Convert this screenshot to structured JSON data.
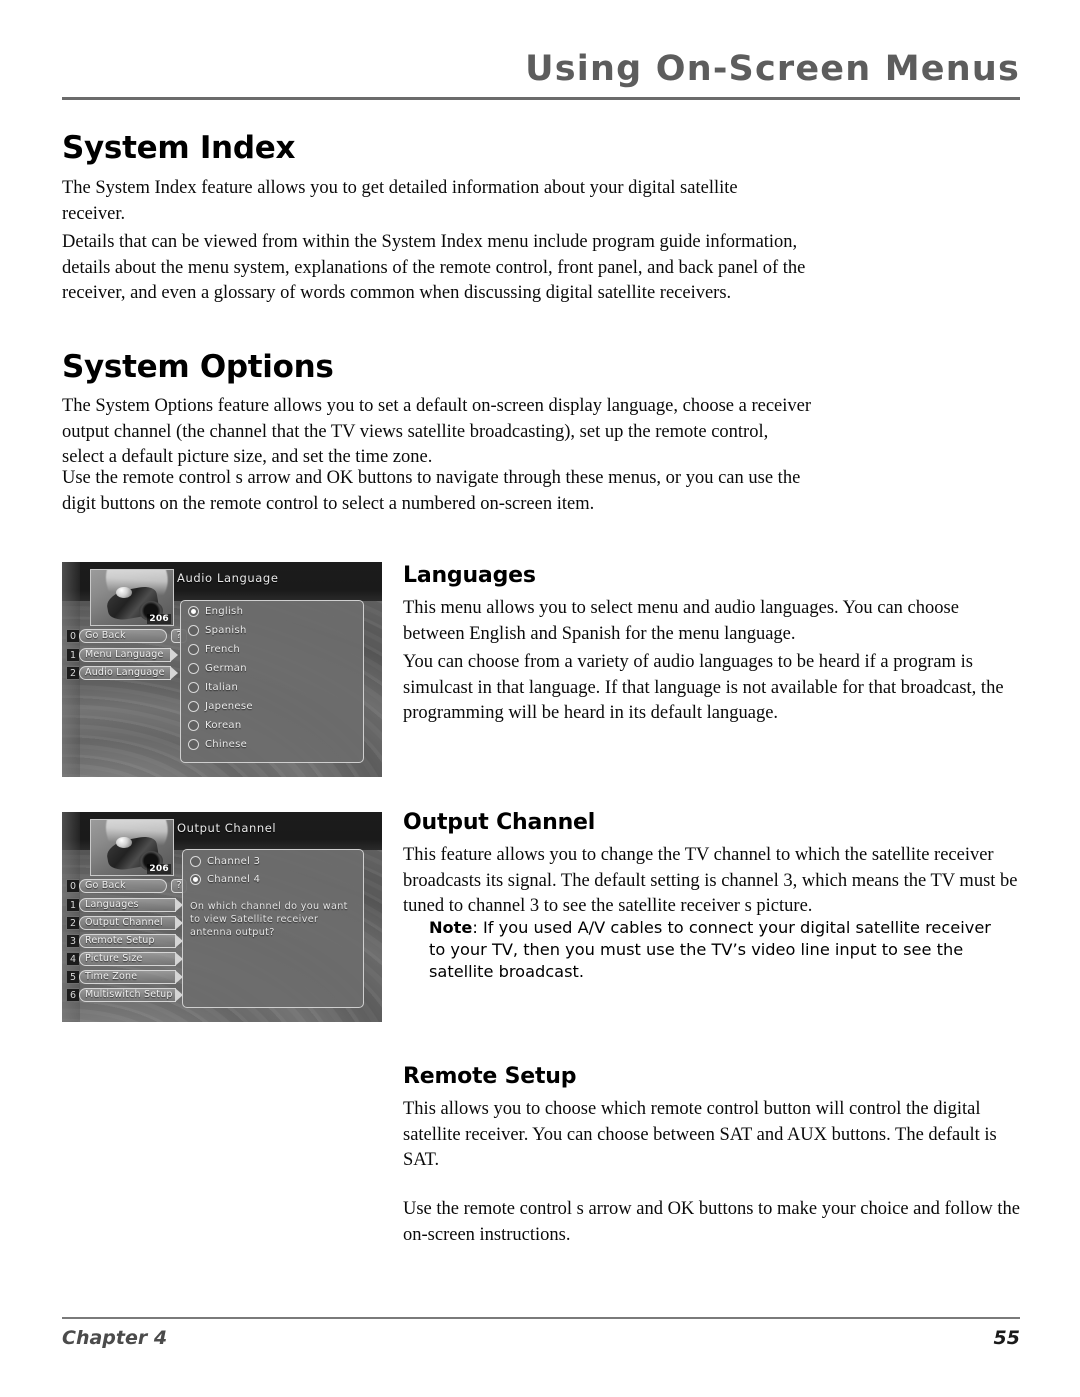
{
  "header": {
    "running_title": "Using On-Screen Menus"
  },
  "sections": [
    {
      "heading": "System Index",
      "paragraphs": [
        "The System Index feature allows you to get detailed information about your digital satellite receiver.",
        "Details that can be viewed from within the System Index menu include program guide information, details about the menu system, explanations of the remote control, front panel, and back panel of the receiver, and even a glossary of words common when discussing digital satellite receivers."
      ]
    },
    {
      "heading": "System Options",
      "paragraphs": [
        "The System Options feature allows you to set a default on-screen display language, choose a receiver output channel (the channel that the TV views satellite broadcasting), set up the remote control, select a default picture size, and set the time zone.",
        "Use the remote control s arrow and OK buttons to navigate through these menus, or you can use the digit buttons on the remote control to select a numbered on-screen item."
      ]
    }
  ],
  "subsections": [
    {
      "heading": "Languages",
      "paragraphs": [
        "This menu allows you to select menu and audio languages. You can choose between English and Spanish for the menu language.",
        "You can choose from a variety of audio languages to be heard if a program is simulcast in that language. If that language is not available for that broadcast, the programming will be heard in its default language."
      ]
    },
    {
      "heading": "Output Channel",
      "paragraphs": [
        "This feature allows you to change the TV channel to which the satellite receiver broadcasts its signal. The default setting is channel 3, which means the TV must be tuned to channel 3 to see the satellite receiver s picture."
      ],
      "note_label": "Note",
      "note_text": ": If you used A/V cables to connect your digital satellite receiver to your TV, then you must use the TV’s video line input to see the satellite broadcast."
    },
    {
      "heading": "Remote Setup",
      "paragraphs": [
        "This allows you to choose which remote control button will control the digital satellite receiver. You can choose between SAT and AUX buttons. The default is SAT.",
        "Use the remote control s arrow and OK buttons to make your choice and follow the on-screen instructions."
      ]
    }
  ],
  "figures": [
    {
      "screen_title": "Audio Language",
      "preview_channel": "206",
      "go_back": {
        "number": "0",
        "label": "Go Back"
      },
      "help": "?",
      "menu_items": [
        {
          "number": "1",
          "label": "Menu Language"
        },
        {
          "number": "2",
          "label": "Audio Language"
        }
      ],
      "options": [
        {
          "label": "English",
          "selected": true
        },
        {
          "label": "Spanish",
          "selected": false
        },
        {
          "label": "French",
          "selected": false
        },
        {
          "label": "German",
          "selected": false
        },
        {
          "label": "Italian",
          "selected": false
        },
        {
          "label": "Japenese",
          "selected": false
        },
        {
          "label": "Korean",
          "selected": false
        },
        {
          "label": "Chinese",
          "selected": false
        }
      ],
      "prompt": ""
    },
    {
      "screen_title": "Output Channel",
      "preview_channel": "206",
      "go_back": {
        "number": "0",
        "label": "Go Back"
      },
      "help": "?",
      "menu_items": [
        {
          "number": "1",
          "label": "Languages"
        },
        {
          "number": "2",
          "label": "Output Channel"
        },
        {
          "number": "3",
          "label": "Remote Setup"
        },
        {
          "number": "4",
          "label": "Picture Size"
        },
        {
          "number": "5",
          "label": "Time Zone"
        },
        {
          "number": "6",
          "label": "Multiswitch Setup"
        }
      ],
      "options": [
        {
          "label": "Channel 3",
          "selected": false
        },
        {
          "label": "Channel 4",
          "selected": true
        }
      ],
      "prompt": "On which channel do you want to view Satellite receiver antenna output?"
    }
  ],
  "footer": {
    "chapter": "Chapter 4",
    "page_number": "55"
  }
}
